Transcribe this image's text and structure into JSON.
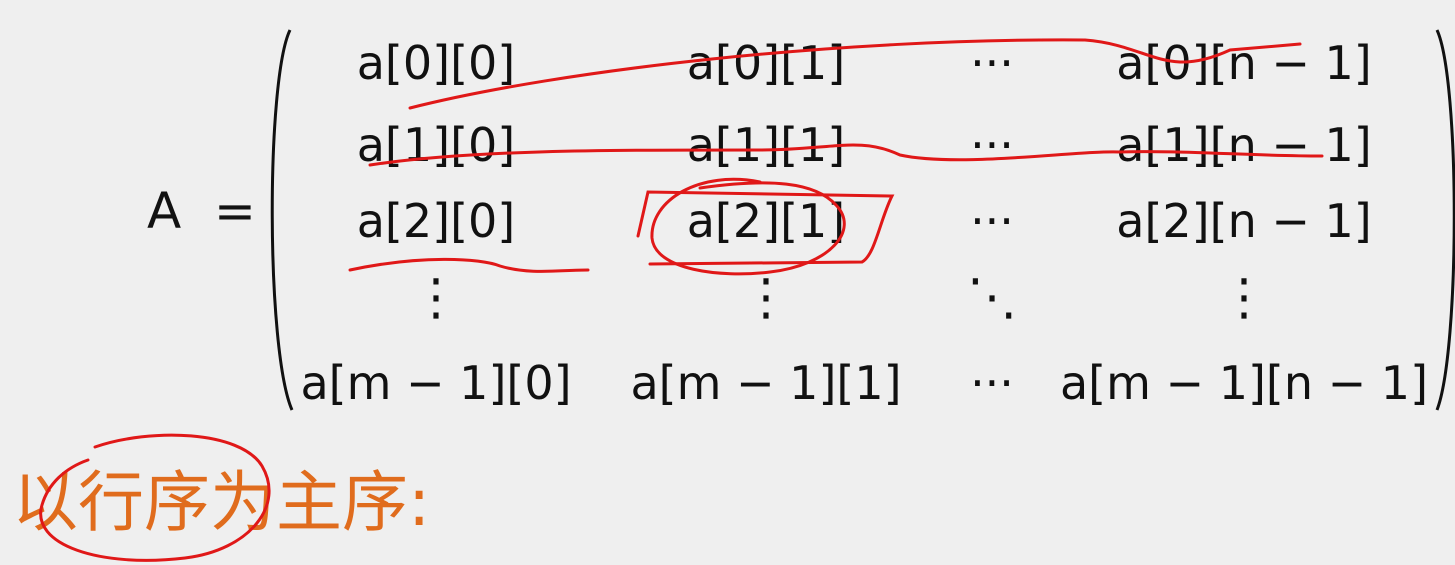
{
  "matrix": {
    "label": "A",
    "equals": "=",
    "rows": [
      [
        "a[0][0]",
        "a[0][1]",
        "···",
        "a[0][n − 1]"
      ],
      [
        "a[1][0]",
        "a[1][1]",
        "···",
        "a[1][n − 1]"
      ],
      [
        "a[2][0]",
        "a[2][1]",
        "···",
        "a[2][n − 1]"
      ],
      [
        "⋮",
        "⋮",
        "⋱",
        "⋮"
      ],
      [
        "a[m − 1][0]",
        "a[m − 1][1]",
        "···",
        "a[m − 1][n − 1]"
      ]
    ]
  },
  "heading": "以行序为主序:",
  "colors": {
    "text": "#111111",
    "heading": "#e06c1d",
    "annotation": "#e01818",
    "background": "#efefef"
  }
}
